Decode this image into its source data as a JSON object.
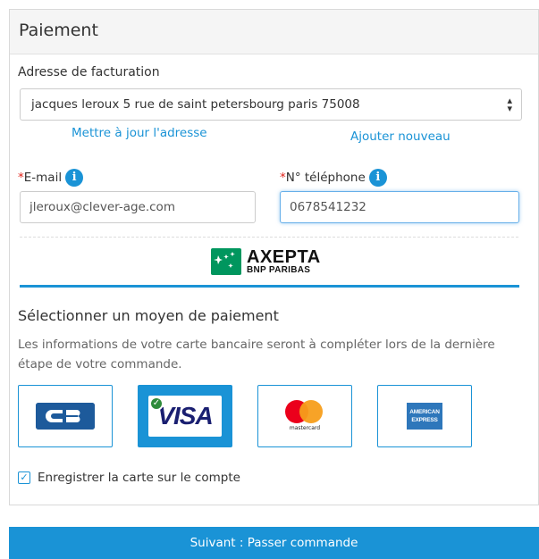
{
  "panel": {
    "title": "Paiement"
  },
  "billing": {
    "label": "Adresse de facturation",
    "selected_address": "jacques leroux 5 rue de saint petersbourg paris 75008",
    "update_link": "Mettre à jour l'adresse",
    "add_link": "Ajouter nouveau"
  },
  "email": {
    "required_mark": "*",
    "label": "E-mail",
    "value": "jleroux@clever-age.com"
  },
  "phone": {
    "required_mark": "*",
    "label": "N° téléphone",
    "value": "0678541232"
  },
  "axepta": {
    "name": "AXEPTA",
    "sub": "BNP PARIBAS"
  },
  "payment": {
    "title": "Sélectionner un moyen de paiement",
    "description": "Les informations de votre carte bancaire seront à compléter lors de la dernière étape de votre commande.",
    "methods": [
      {
        "id": "cb",
        "label": "CB",
        "selected": false
      },
      {
        "id": "visa",
        "label": "VISA",
        "selected": true
      },
      {
        "id": "mastercard",
        "label": "mastercard",
        "selected": false
      },
      {
        "id": "amex",
        "label": "AMERICAN EXPRESS",
        "selected": false
      }
    ]
  },
  "save_card": {
    "checked": true,
    "label": "Enregistrer la carte sur le compte"
  },
  "submit": {
    "label": "Suivant : Passer commande"
  },
  "colors": {
    "accent": "#1a93d6",
    "required": "#e2231a",
    "axepta_green": "#00965e"
  }
}
